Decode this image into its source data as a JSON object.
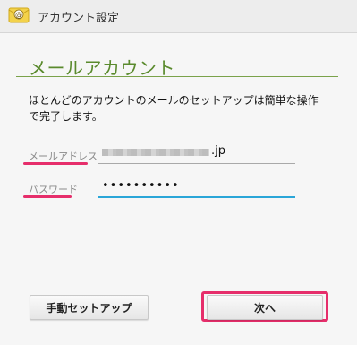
{
  "titlebar": {
    "title": "アカウント設定"
  },
  "section": {
    "heading": "メールアカウント",
    "description": "ほとんどのアカウントのメールのセットアップは簡単な操作で完了します。"
  },
  "form": {
    "email_label": "メールアドレス",
    "email_value_visible": ".jp",
    "password_label": "パスワード",
    "password_value": "••••••••••"
  },
  "buttons": {
    "manual_setup": "手動セットアップ",
    "next": "次へ"
  },
  "colors": {
    "accent_green": "#5a8a2d",
    "highlight_pink": "#e62e6b",
    "focus_blue": "#2aa6d8"
  },
  "icons": {
    "app": "email-app-icon"
  }
}
